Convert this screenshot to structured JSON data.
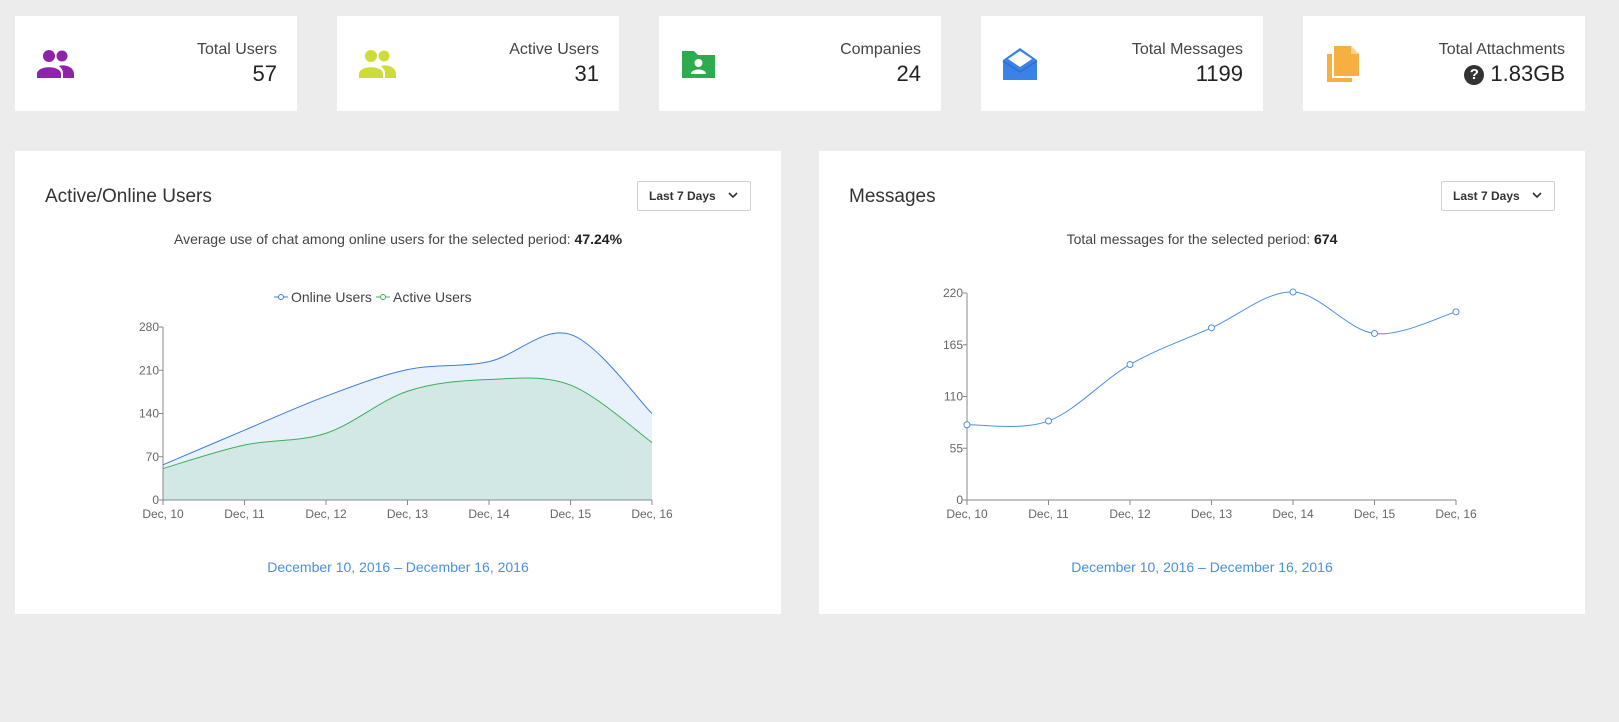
{
  "stats": [
    {
      "label": "Total Users",
      "value": "57",
      "icon": "users-icon",
      "color": "#8e24aa"
    },
    {
      "label": "Active Users",
      "value": "31",
      "icon": "users-icon",
      "color": "#cddc39"
    },
    {
      "label": "Companies",
      "value": "24",
      "icon": "folder-user-icon",
      "color": "#2eaa4f"
    },
    {
      "label": "Total Messages",
      "value": "1199",
      "icon": "envelope-open-icon",
      "color": "#3b82e8"
    },
    {
      "label": "Total Attachments",
      "value": "1.83GB",
      "icon": "files-icon",
      "color": "#f5b041"
    }
  ],
  "active_panel": {
    "title": "Active/Online Users",
    "dropdown": "Last 7 Days",
    "summary_text": "Average use of chat among online users for the selected period:",
    "summary_value": "47.24%",
    "range": "December 10, 2016 – December 16, 2016"
  },
  "messages_panel": {
    "title": "Messages",
    "dropdown": "Last 7 Days",
    "summary_text": "Total messages for the selected period:",
    "summary_value": "674",
    "range": "December 10, 2016 – December 16, 2016"
  },
  "colors": {
    "online": "#3b7dd8",
    "active": "#3fae5a",
    "messages": "#4a90e2",
    "range_link": "#4a90e2"
  },
  "chart_data": [
    {
      "type": "area",
      "categories": [
        "Dec, 10",
        "Dec, 11",
        "Dec, 12",
        "Dec, 13",
        "Dec, 14",
        "Dec, 15",
        "Dec, 16"
      ],
      "series": [
        {
          "name": "Online Users",
          "values": [
            57,
            113,
            168,
            211,
            224,
            268,
            140
          ]
        },
        {
          "name": "Active Users",
          "values": [
            51,
            89,
            108,
            176,
            195,
            186,
            93
          ]
        }
      ],
      "yticks": [
        "0",
        "70",
        "140",
        "210",
        "280"
      ],
      "ylim": [
        0,
        280
      ],
      "legend": "top-center"
    },
    {
      "type": "line",
      "categories": [
        "Dec, 10",
        "Dec, 11",
        "Dec, 12",
        "Dec, 13",
        "Dec, 14",
        "Dec, 15",
        "Dec, 16"
      ],
      "series": [
        {
          "values": [
            80,
            84,
            144,
            183,
            221,
            177,
            200
          ]
        }
      ],
      "yticks": [
        "0",
        "55",
        "110",
        "165",
        "220"
      ],
      "ylim": [
        0,
        220
      ]
    }
  ]
}
